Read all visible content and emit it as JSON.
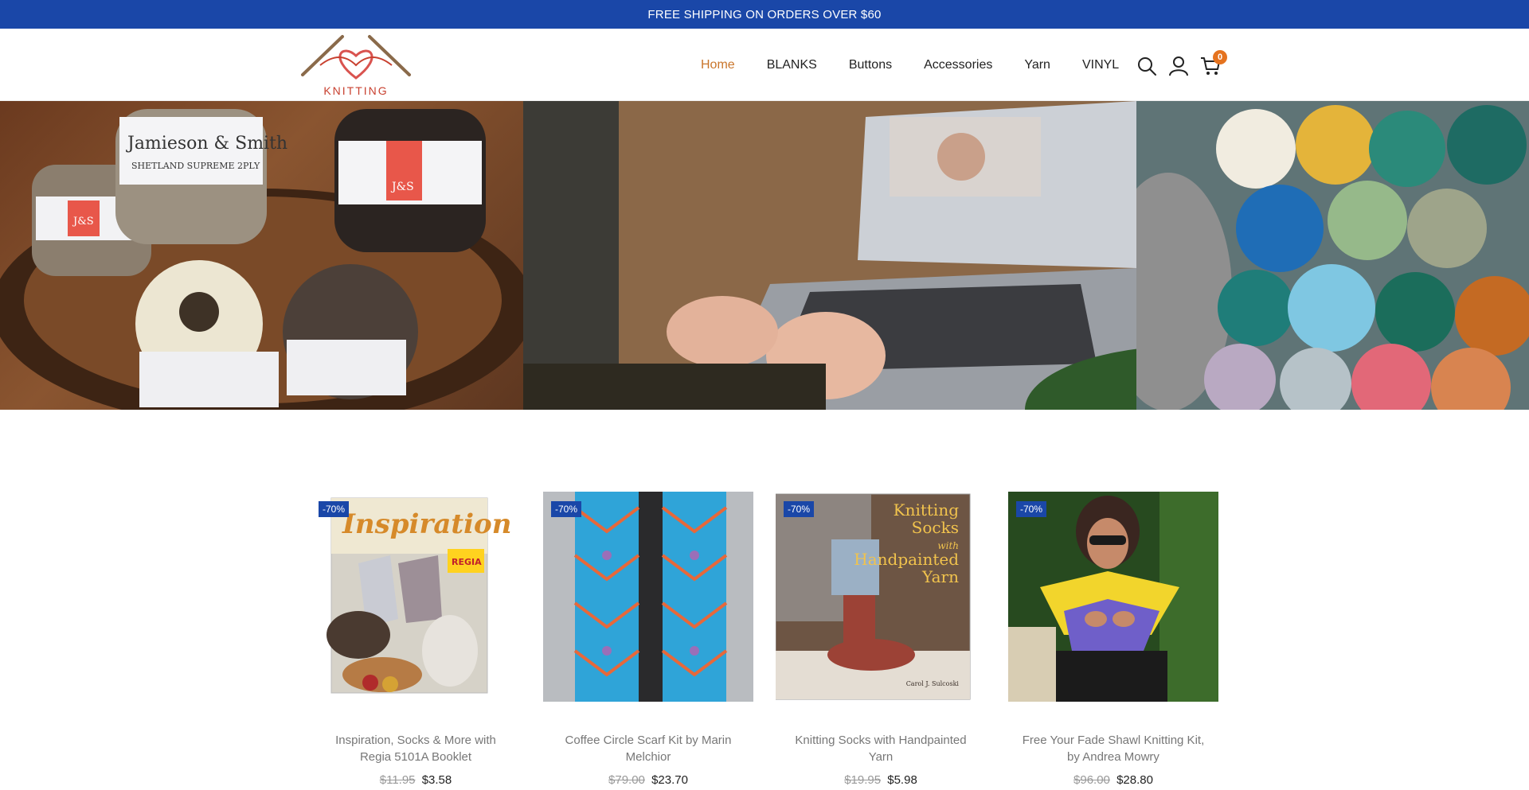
{
  "announcement": "FREE SHIPPING ON ORDERS OVER $60",
  "logo": {
    "text": "KNITTING"
  },
  "nav": [
    {
      "label": "Home",
      "active": true
    },
    {
      "label": "BLANKS",
      "active": false
    },
    {
      "label": "Buttons",
      "active": false
    },
    {
      "label": "Accessories",
      "active": false
    },
    {
      "label": "Yarn",
      "active": false
    },
    {
      "label": "VINYL",
      "active": false
    }
  ],
  "header_icons": {
    "search": "search-icon",
    "account": "user-icon",
    "cart": "cart-icon",
    "cart_count": "0"
  },
  "hero": {
    "panels": [
      {
        "name": "yarn-basket-image",
        "labels": [
          "Jamieson & Smith",
          "SHETLAND SUPREME 2PLY",
          "J&S"
        ]
      },
      {
        "name": "knitting-laptop-image",
        "labels": []
      },
      {
        "name": "colorful-yarn-image",
        "labels": []
      }
    ]
  },
  "products": [
    {
      "badge": "-70%",
      "title": "Inspiration, Socks & More with Regia 5101A Booklet",
      "old_price": "$11.95",
      "price": "$3.58",
      "cover_text": "Inspiration",
      "sub_text": "REGIA"
    },
    {
      "badge": "-70%",
      "title": "Coffee Circle Scarf Kit by Marin Melchior",
      "old_price": "$79.00",
      "price": "$23.70"
    },
    {
      "badge": "-70%",
      "title": "Knitting Socks with Handpainted Yarn",
      "old_price": "$19.95",
      "price": "$5.98",
      "cover_lines": [
        "Knitting",
        "Socks",
        "with",
        "Handpainted",
        "Yarn"
      ],
      "author": "Carol J. Sulcoski"
    },
    {
      "badge": "-70%",
      "title": "Free Your Fade Shawl Knitting Kit, by Andrea Mowry",
      "old_price": "$96.00",
      "price": "$28.80"
    }
  ],
  "colors": {
    "announce_bg": "#1a47a8",
    "active_nav": "#c9752a",
    "cart_badge": "#e5731f",
    "logo_red": "#c8402f"
  }
}
